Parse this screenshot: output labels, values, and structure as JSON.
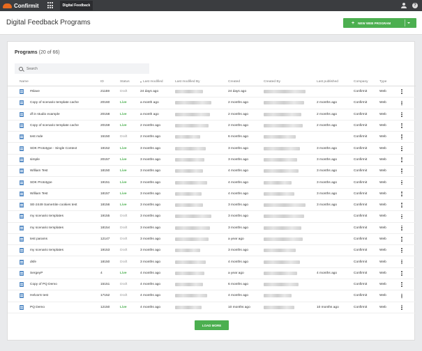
{
  "topbar": {
    "brand": "Confirmit",
    "app_title": "Digital Feedback"
  },
  "header": {
    "title": "Digital Feedback Programs",
    "new_button_label": "NEW WEB PROGRAM"
  },
  "programs": {
    "title": "Programs",
    "count": "(20 of 66)",
    "search_placeholder": "Search",
    "columns": [
      "Name",
      "ID",
      "Status",
      "Last modified",
      "Last modified By",
      "Created",
      "Created By",
      "Last published",
      "Company",
      "Type"
    ],
    "rows": [
      {
        "name": "#slave",
        "id": "21159",
        "status": "Draft",
        "last_modified": "24 days ago",
        "created": "24 days ago",
        "last_published": "",
        "company": "Confirmit",
        "type": "Web"
      },
      {
        "name": "Copy of scenario template cache",
        "id": "20160",
        "status": "Live",
        "last_modified": "a month ago",
        "created": "2 months ago",
        "last_published": "2 months ago",
        "company": "Confirmit",
        "type": "Web"
      },
      {
        "name": "df in studio example",
        "id": "20158",
        "status": "Live",
        "last_modified": "a month ago",
        "created": "2 months ago",
        "last_published": "2 months ago",
        "company": "Confirmit",
        "type": "Web"
      },
      {
        "name": "Copy of scenario template cache",
        "id": "20159",
        "status": "Live",
        "last_modified": "2 months ago",
        "created": "2 months ago",
        "last_published": "2 months ago",
        "company": "Confirmit",
        "type": "Web"
      },
      {
        "name": "test mde",
        "id": "15150",
        "status": "Draft",
        "last_modified": "2 months ago",
        "created": "6 months ago",
        "last_published": "",
        "company": "Confirmit",
        "type": "Web"
      },
      {
        "name": "SDK Prototype - Single Context",
        "id": "19152",
        "status": "Live",
        "last_modified": "3 months ago",
        "created": "3 months ago",
        "last_published": "3 months ago",
        "company": "Confirmit",
        "type": "Web"
      },
      {
        "name": "simple",
        "id": "20157",
        "status": "Live",
        "last_modified": "3 months ago",
        "created": "3 months ago",
        "last_published": "3 months ago",
        "company": "Confirmit",
        "type": "Web"
      },
      {
        "name": "William Test",
        "id": "18150",
        "status": "Live",
        "last_modified": "3 months ago",
        "created": "4 months ago",
        "last_published": "3 months ago",
        "company": "Confirmit",
        "type": "Web"
      },
      {
        "name": "SDK Prototype",
        "id": "19151",
        "status": "Live",
        "last_modified": "3 months ago",
        "created": "4 months ago",
        "last_published": "3 months ago",
        "company": "Confirmit",
        "type": "Web"
      },
      {
        "name": "William Test",
        "id": "18157",
        "status": "Live",
        "last_modified": "3 months ago",
        "created": "4 months ago",
        "last_published": "3 months ago",
        "company": "Confirmit",
        "type": "Web"
      },
      {
        "name": "SE-2449 SameSite cookies test",
        "id": "18156",
        "status": "Live",
        "last_modified": "3 months ago",
        "created": "3 months ago",
        "last_published": "3 months ago",
        "company": "Confirmit",
        "type": "Web"
      },
      {
        "name": "my scenario templates",
        "id": "19155",
        "status": "Draft",
        "last_modified": "3 months ago",
        "created": "3 months ago",
        "last_published": "",
        "company": "Confirmit",
        "type": "Web"
      },
      {
        "name": "my scenario templates",
        "id": "18154",
        "status": "Draft",
        "last_modified": "3 months ago",
        "created": "3 months ago",
        "last_published": "",
        "company": "Confirmit",
        "type": "Web"
      },
      {
        "name": "test params",
        "id": "12147",
        "status": "Draft",
        "last_modified": "3 months ago",
        "created": "a year ago",
        "last_published": "",
        "company": "Confirmit",
        "type": "Web"
      },
      {
        "name": "my scenario templates",
        "id": "19153",
        "status": "Draft",
        "last_modified": "3 months ago",
        "created": "3 months ago",
        "last_published": "",
        "company": "Confirmit",
        "type": "Web"
      },
      {
        "name": "dsfe",
        "id": "18150",
        "status": "Draft",
        "last_modified": "3 months ago",
        "created": "4 months ago",
        "last_published": "",
        "company": "Confirmit",
        "type": "Web"
      },
      {
        "name": "SergeyP",
        "id": "4",
        "status": "Live",
        "last_modified": "4 months ago",
        "created": "a year ago",
        "last_published": "4 months ago",
        "company": "Confirmit",
        "type": "Web"
      },
      {
        "name": "Copy of PQ Demo",
        "id": "15151",
        "status": "Draft",
        "last_modified": "4 months ago",
        "created": "6 months ago",
        "last_published": "",
        "company": "Confirmit",
        "type": "Web"
      },
      {
        "name": "HelvorS test",
        "id": "17152",
        "status": "Draft",
        "last_modified": "4 months ago",
        "created": "4 months ago",
        "last_published": "",
        "company": "Confirmit",
        "type": "Web"
      },
      {
        "name": "PQ Demo",
        "id": "12150",
        "status": "Live",
        "last_modified": "4 months ago",
        "created": "10 months ago",
        "last_published": "10 months ago",
        "company": "Confirmit",
        "type": "Web"
      }
    ],
    "load_more_label": "LOAD MORE"
  },
  "colors": {
    "accent": "#4caf50",
    "topbar": "#3b3d40",
    "brand": "#e86a1e",
    "doc_icon": "#5b8fc7"
  }
}
